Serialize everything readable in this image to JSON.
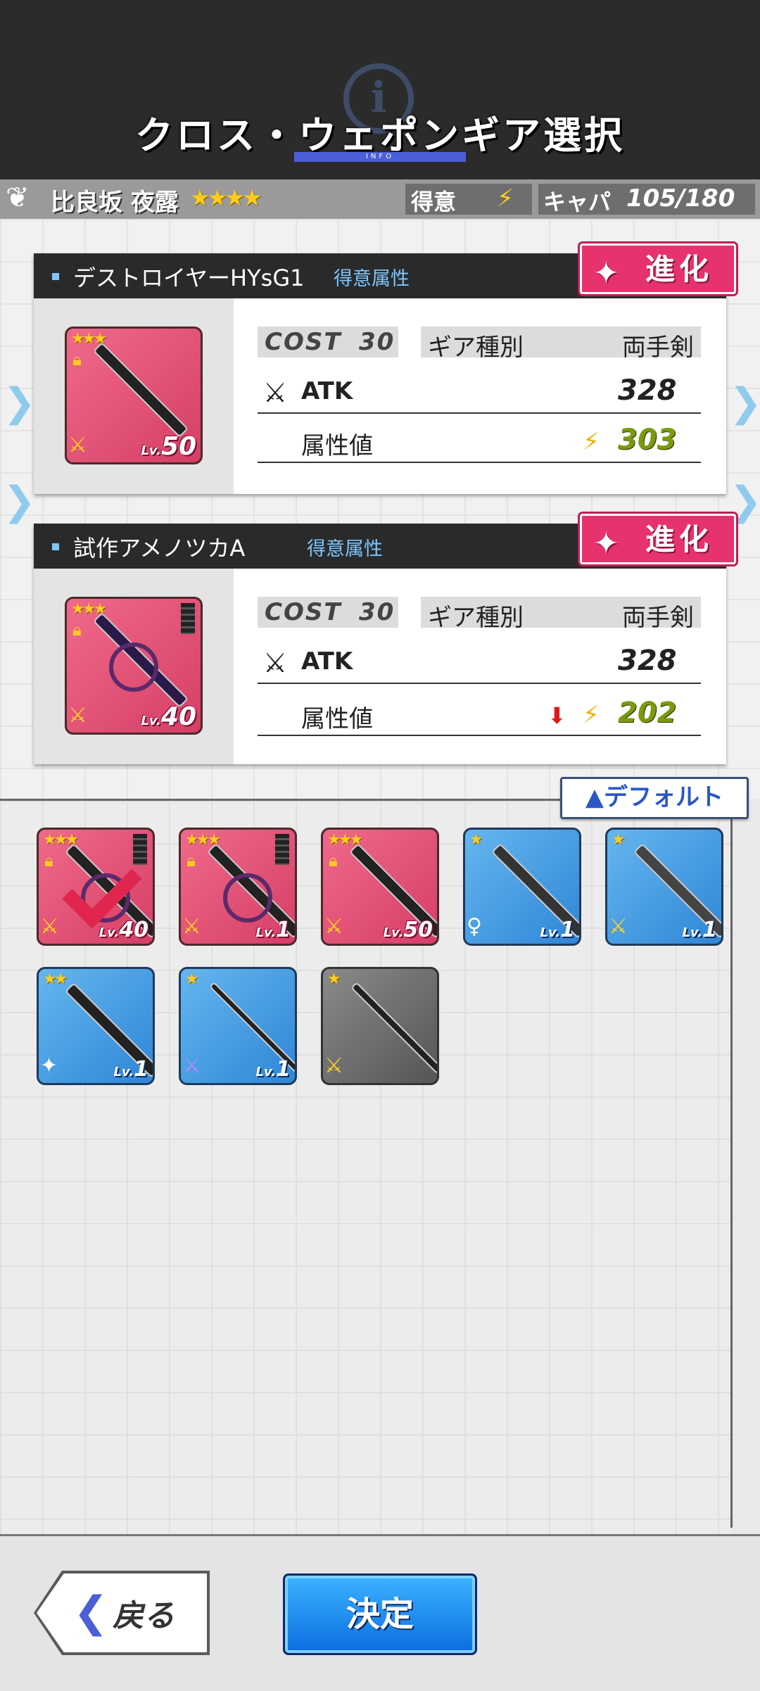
{
  "header": {
    "title": "クロス・ウェポンギア選択",
    "info_label": "INFO",
    "info_glyph": "i"
  },
  "character": {
    "emblem": "❦",
    "name": "比良坂 夜露",
    "stars": "★★★★"
  },
  "status": {
    "tokui_label": "得意",
    "tokui_icon": "⚡",
    "capacity_label": "キャパ",
    "capacity_value": "105/180"
  },
  "gears": [
    {
      "name": "デストロイヤーHYsG1",
      "tag": "得意属性",
      "evolve_label": "進化",
      "evolve_icon": "✦",
      "stars": "★★★",
      "level_prefix": "Lv.",
      "level": "50",
      "cost_label": "COST",
      "cost_value": "30",
      "type_label": "ギア種別",
      "type_value": "両手剣",
      "atk_label": "ATK",
      "atk_value": "328",
      "attr_label": "属性値",
      "attr_value": "303",
      "attr_down": false
    },
    {
      "name": "試作アメノツカA",
      "tag": "得意属性",
      "evolve_label": "進化",
      "evolve_icon": "✦",
      "stars": "★★★",
      "level_prefix": "Lv.",
      "level": "40",
      "cost_label": "COST",
      "cost_value": "30",
      "type_label": "ギア種別",
      "type_value": "両手剣",
      "atk_label": "ATK",
      "atk_value": "328",
      "attr_label": "属性値",
      "attr_value": "202",
      "attr_down": true,
      "down_arrow": "⬇"
    }
  ],
  "default_button": "▲デフォルト",
  "inventory": [
    {
      "stars": "★★★",
      "level_prefix": "Lv.",
      "level": "40",
      "color": "pink",
      "selected": true
    },
    {
      "stars": "★★★",
      "level_prefix": "Lv.",
      "level": "1",
      "color": "pink",
      "selected": false
    },
    {
      "stars": "★★★",
      "level_prefix": "Lv.",
      "level": "50",
      "color": "pink",
      "selected": false
    },
    {
      "stars": "★",
      "level_prefix": "Lv.",
      "level": "1",
      "color": "blue",
      "selected": false
    },
    {
      "stars": "★",
      "level_prefix": "Lv.",
      "level": "1",
      "color": "blue",
      "selected": false
    },
    {
      "stars": "★★",
      "level_prefix": "Lv.",
      "level": "1",
      "color": "blue",
      "selected": false
    },
    {
      "stars": "★",
      "level_prefix": "Lv.",
      "level": "1",
      "color": "blue",
      "selected": false
    },
    {
      "stars": "★",
      "level_prefix": "",
      "level": "",
      "color": "gray",
      "selected": false
    }
  ],
  "footer": {
    "back_chevron": "❮",
    "back_label": "戻る",
    "ok_label": "決定"
  },
  "chevron_glyph": "❯",
  "colors": {
    "accent_pink": "#e6336e",
    "accent_blue": "#0a6de0",
    "header_bg": "#2b2b2b"
  }
}
